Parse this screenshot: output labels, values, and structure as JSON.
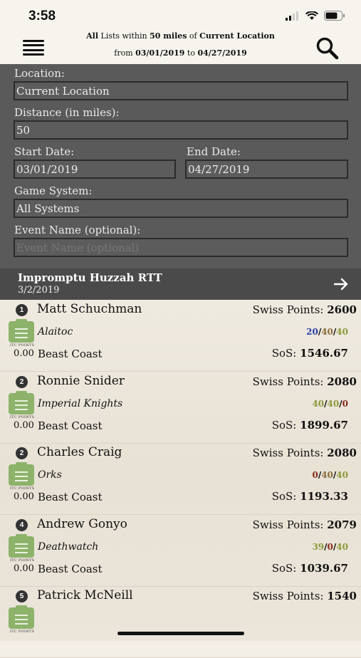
{
  "status_bar": {
    "time": "3:58"
  },
  "header": {
    "line1_pre": "All",
    "line1_mid1": " Lists within ",
    "line1_dist": "50 miles",
    "line1_mid2": " of ",
    "line1_loc": "Current Location",
    "line2_pre": "from ",
    "line2_start": "03/01/2019",
    "line2_mid": " to ",
    "line2_end": "04/27/2019"
  },
  "form": {
    "location_label": "Location:",
    "location_value": "Current Location",
    "distance_label": "Distance (in miles):",
    "distance_value": "50",
    "start_label": "Start Date:",
    "start_value": "03/01/2019",
    "end_label": "End Date:",
    "end_value": "04/27/2019",
    "system_label": "Game System:",
    "system_value": "All Systems",
    "event_name_label": "Event Name (optional):",
    "event_name_placeholder": "Event Name (optional)"
  },
  "event": {
    "title": "Impromptu Huzzah RTT",
    "date": "3/2/2019"
  },
  "list": {
    "swiss_label": "Swiss Points:",
    "sos_label": "SoS:",
    "itc_label": "ITC POINTS",
    "rows": [
      {
        "rank": "1",
        "name": "Matt Schuchman",
        "swiss": "2600",
        "faction": "Alaitoc",
        "s1": "20",
        "s2": "40",
        "s3": "40",
        "c1": "#2b3fa8",
        "c2": "#8b6b3a",
        "c3": "#8a9a3a",
        "itc": "0.00",
        "region": "Beast Coast",
        "sos": "1546.67"
      },
      {
        "rank": "2",
        "name": "Ronnie Snider",
        "swiss": "2080",
        "faction": "Imperial Knights",
        "s1": "40",
        "s2": "40",
        "s3": "0",
        "c1": "#8a9a3a",
        "c2": "#8a9a3a",
        "c3": "#8a2a1a",
        "itc": "0.00",
        "region": "Beast Coast",
        "sos": "1899.67"
      },
      {
        "rank": "2",
        "name": "Charles Craig",
        "swiss": "2080",
        "faction": "Orks",
        "s1": "0",
        "s2": "40",
        "s3": "40",
        "c1": "#8a2a1a",
        "c2": "#8b6b3a",
        "c3": "#8a9a3a",
        "itc": "0.00",
        "region": "Beast Coast",
        "sos": "1193.33"
      },
      {
        "rank": "4",
        "name": "Andrew Gonyo",
        "swiss": "2079",
        "faction": "Deathwatch",
        "s1": "39",
        "s2": "0",
        "s3": "40",
        "c1": "#8a9a3a",
        "c2": "#8a2a1a",
        "c3": "#8a9a3a",
        "itc": "0.00",
        "region": "Beast Coast",
        "sos": "1039.67"
      },
      {
        "rank": "5",
        "name": "Patrick McNeill",
        "swiss": "1540",
        "faction": "",
        "s1": "",
        "s2": "",
        "s3": "",
        "c1": "#8a9a3a",
        "c2": "#8a9a3a",
        "c3": "#8a9a3a",
        "itc": "",
        "region": "",
        "sos": ""
      }
    ]
  }
}
